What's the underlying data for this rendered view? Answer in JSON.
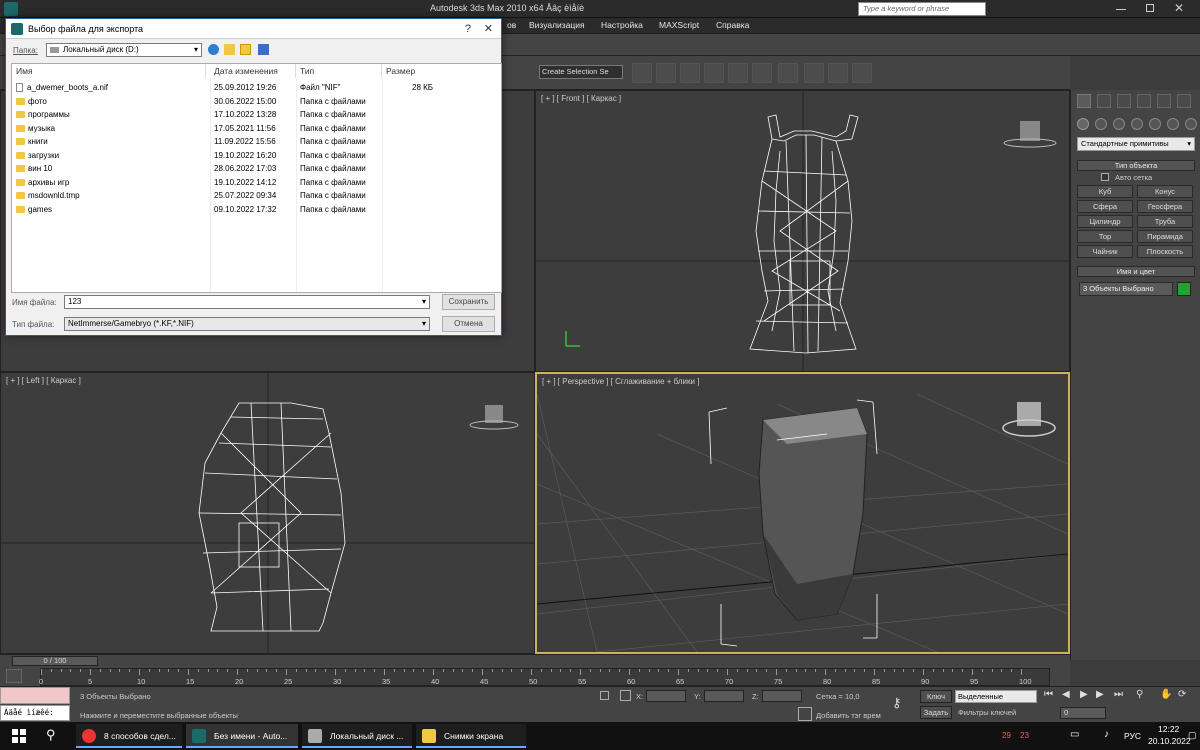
{
  "app": {
    "title": "Autodesk 3ds Max  2010 x64    Åâç èìåíè",
    "search_placeholder": "Type a keyword or phrase"
  },
  "menus": [
    "ов",
    "Визуализация",
    "Настройка",
    "MAXScript",
    "Справка"
  ],
  "toolbar": {
    "selection_set": "Create Selection Se"
  },
  "viewports": {
    "front": "[ + ] [ Front ] [ Каркас ]",
    "left": "[ + ] [ Left ] [ Каркас ]",
    "perspective": "[ + ] [ Perspective ] [ Сглаживание + блики ]"
  },
  "command_panel": {
    "dropdown": "Стандартные примитивы",
    "object_type_title": "Тип объекта",
    "auto_grid": "Авто сетка",
    "buttons": [
      "Куб",
      "Конус",
      "Сфера",
      "Геосфера",
      "Цилиндр",
      "Труба",
      "Тор",
      "Пирамида",
      "Чайник",
      "Плоскость"
    ],
    "name_color_title": "Имя и цвет",
    "name_value": "3 Объекты Выбрано"
  },
  "dialog": {
    "title": "Выбор файла для экспорта",
    "folder_label": "Папка:",
    "folder_value": "Локальный диск (D:)",
    "columns": [
      "Имя",
      "Дата изменения",
      "Тип",
      "Размер"
    ],
    "files": [
      {
        "name": "a_dwemer_boots_a.nif",
        "date": "25.09.2012 19:26",
        "type": "Файл \"NIF\"",
        "size": "28 КБ",
        "kind": "file"
      },
      {
        "name": "фото",
        "date": "30.06.2022 15:00",
        "type": "Папка с файлами",
        "size": "",
        "kind": "folder"
      },
      {
        "name": "программы",
        "date": "17.10.2022 13:28",
        "type": "Папка с файлами",
        "size": "",
        "kind": "folder"
      },
      {
        "name": "музыка",
        "date": "17.05.2021 11:56",
        "type": "Папка с файлами",
        "size": "",
        "kind": "folder"
      },
      {
        "name": "книги",
        "date": "11.09.2022 15:56",
        "type": "Папка с файлами",
        "size": "",
        "kind": "folder"
      },
      {
        "name": "загрузки",
        "date": "19.10.2022 16:20",
        "type": "Папка с файлами",
        "size": "",
        "kind": "folder"
      },
      {
        "name": "вин 10",
        "date": "28.06.2022 17:03",
        "type": "Папка с файлами",
        "size": "",
        "kind": "folder"
      },
      {
        "name": "архивы игр",
        "date": "19.10.2022 14:12",
        "type": "Папка с файлами",
        "size": "",
        "kind": "folder"
      },
      {
        "name": "msdownld.tmp",
        "date": "25.07.2022 09:34",
        "type": "Папка с файлами",
        "size": "",
        "kind": "folder"
      },
      {
        "name": "games",
        "date": "09.10.2022 17:32",
        "type": "Папка с файлами",
        "size": "",
        "kind": "folder"
      }
    ],
    "filename_label": "Имя файла:",
    "filename_value": "123",
    "filetype_label": "Тип файла:",
    "filetype_value": "NetImmerse/Gamebryo (*.KF,*.NIF)",
    "save_label": "Сохранить",
    "cancel_label": "Отмена"
  },
  "timeline": {
    "frame": "0 / 100",
    "ticks": [
      "0",
      "5",
      "10",
      "15",
      "20",
      "25",
      "30",
      "35",
      "40",
      "45",
      "50",
      "55",
      "60",
      "65",
      "70",
      "75",
      "80",
      "85",
      "90",
      "95",
      "100"
    ]
  },
  "status": {
    "selected": "3 Объекты Выбрано",
    "prompt": "Нажмите и переместите выбранные объекты",
    "x_label": "X:",
    "y_label": "Y:",
    "z_label": "Z:",
    "grid": "Сетка = 10,0",
    "add_tag": "Добавить тэг врем",
    "key_label": "Ключ",
    "set_label": "Задать",
    "key_mode": "Выделенные",
    "key_filters": "Фильтры ключей",
    "frame_value": "0",
    "maxscript_text": "Àäåé ìíæêé:"
  },
  "taskbar": {
    "tasks": [
      "8 способов сдел...",
      "Без имени - Auto...",
      "Локальный диск ...",
      "Снимки экрана"
    ],
    "lang": "РУС",
    "time": "12:22",
    "date": "20.10.2022",
    "tray_nums": [
      "29",
      "23"
    ]
  },
  "colors": {
    "accent": "#6aa4ff",
    "viewport_active": "#c8b45a",
    "swatch": "#1fa62e"
  }
}
